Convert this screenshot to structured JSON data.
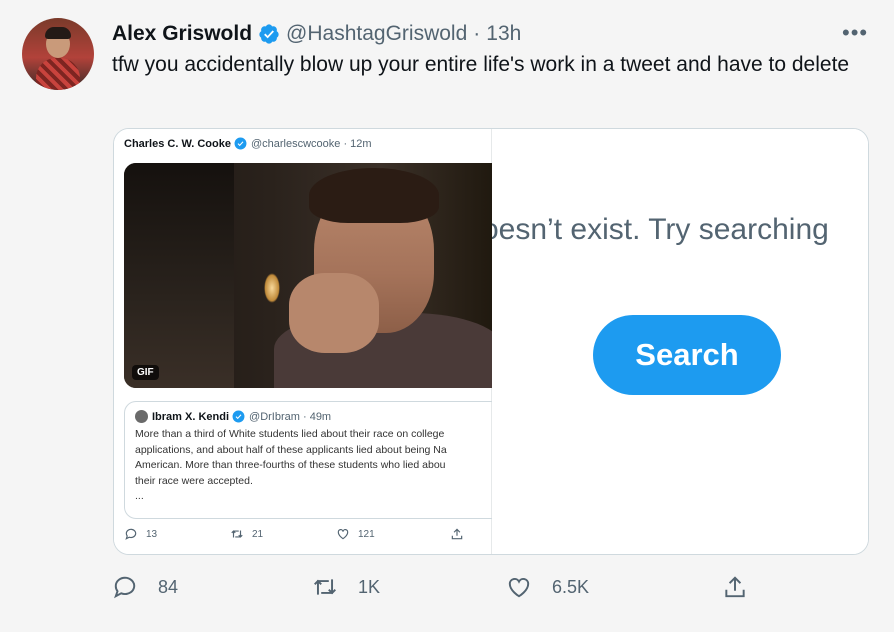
{
  "tweet": {
    "author_name": "Alex Griswold",
    "handle": "@HashtagGriswold",
    "separator": "·",
    "time": "13h",
    "more_label": "•••",
    "text": "tfw you accidentally blow up your entire life's work in a tweet and have to delete"
  },
  "screenshot": {
    "inner_author": "Charles C. W. Cooke",
    "inner_handle": "@charlescwcooke · 12m",
    "gif_badge": "GIF",
    "quote_author": "Ibram X. Kendi",
    "quote_handle": "@DrIbram · 49m",
    "quote_text": "More than a third of White students lied about their race on college\napplications, and about half of these applicants lied about being Na\nAmerican. More than three-fourths of these students who lied abou\ntheir race were accepted.\n...",
    "inner_replies": "13",
    "inner_retweets": "21",
    "inner_likes": "121",
    "error_text": "oesn’t exist. Try searching",
    "search_button": "Search"
  },
  "actions": {
    "replies": "84",
    "retweets": "1K",
    "likes": "6.5K"
  },
  "colors": {
    "accent": "#1d9bf0",
    "secondary_text": "#536471",
    "background": "#f5f5f5"
  },
  "icons": [
    "verified-badge-icon",
    "more-icon",
    "reply-icon",
    "retweet-icon",
    "like-icon",
    "share-icon"
  ]
}
